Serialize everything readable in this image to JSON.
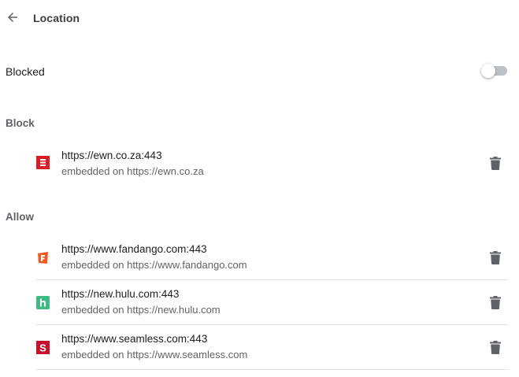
{
  "header": {
    "title": "Location",
    "back_icon": "arrow-back-icon"
  },
  "blocked_setting": {
    "label": "Blocked",
    "toggle_on": false
  },
  "block_section": {
    "title": "Block",
    "sites": [
      {
        "url": "https://ewn.co.za:443",
        "embedded": "embedded on https://ewn.co.za",
        "favicon": "ewn-favicon",
        "favicon_color": "#d71f26",
        "delete_icon": "trash-icon"
      }
    ]
  },
  "allow_section": {
    "title": "Allow",
    "sites": [
      {
        "url": "https://www.fandango.com:443",
        "embedded": "embedded on https://www.fandango.com",
        "favicon": "fandango-favicon",
        "favicon_color": "#f15a24",
        "delete_icon": "trash-icon"
      },
      {
        "url": "https://new.hulu.com:443",
        "embedded": "embedded on https://new.hulu.com",
        "favicon": "hulu-favicon",
        "favicon_color": "#3dbb83",
        "delete_icon": "trash-icon"
      },
      {
        "url": "https://www.seamless.com:443",
        "embedded": "embedded on https://www.seamless.com",
        "favicon": "seamless-favicon",
        "favicon_color": "#c8102e",
        "delete_icon": "trash-icon"
      }
    ]
  },
  "colors": {
    "text_primary": "#202124",
    "text_secondary": "#5f6368",
    "icon_gray": "#5f6368",
    "toggle_track_off": "#bdc1c6",
    "divider": "#e3e3e3"
  }
}
